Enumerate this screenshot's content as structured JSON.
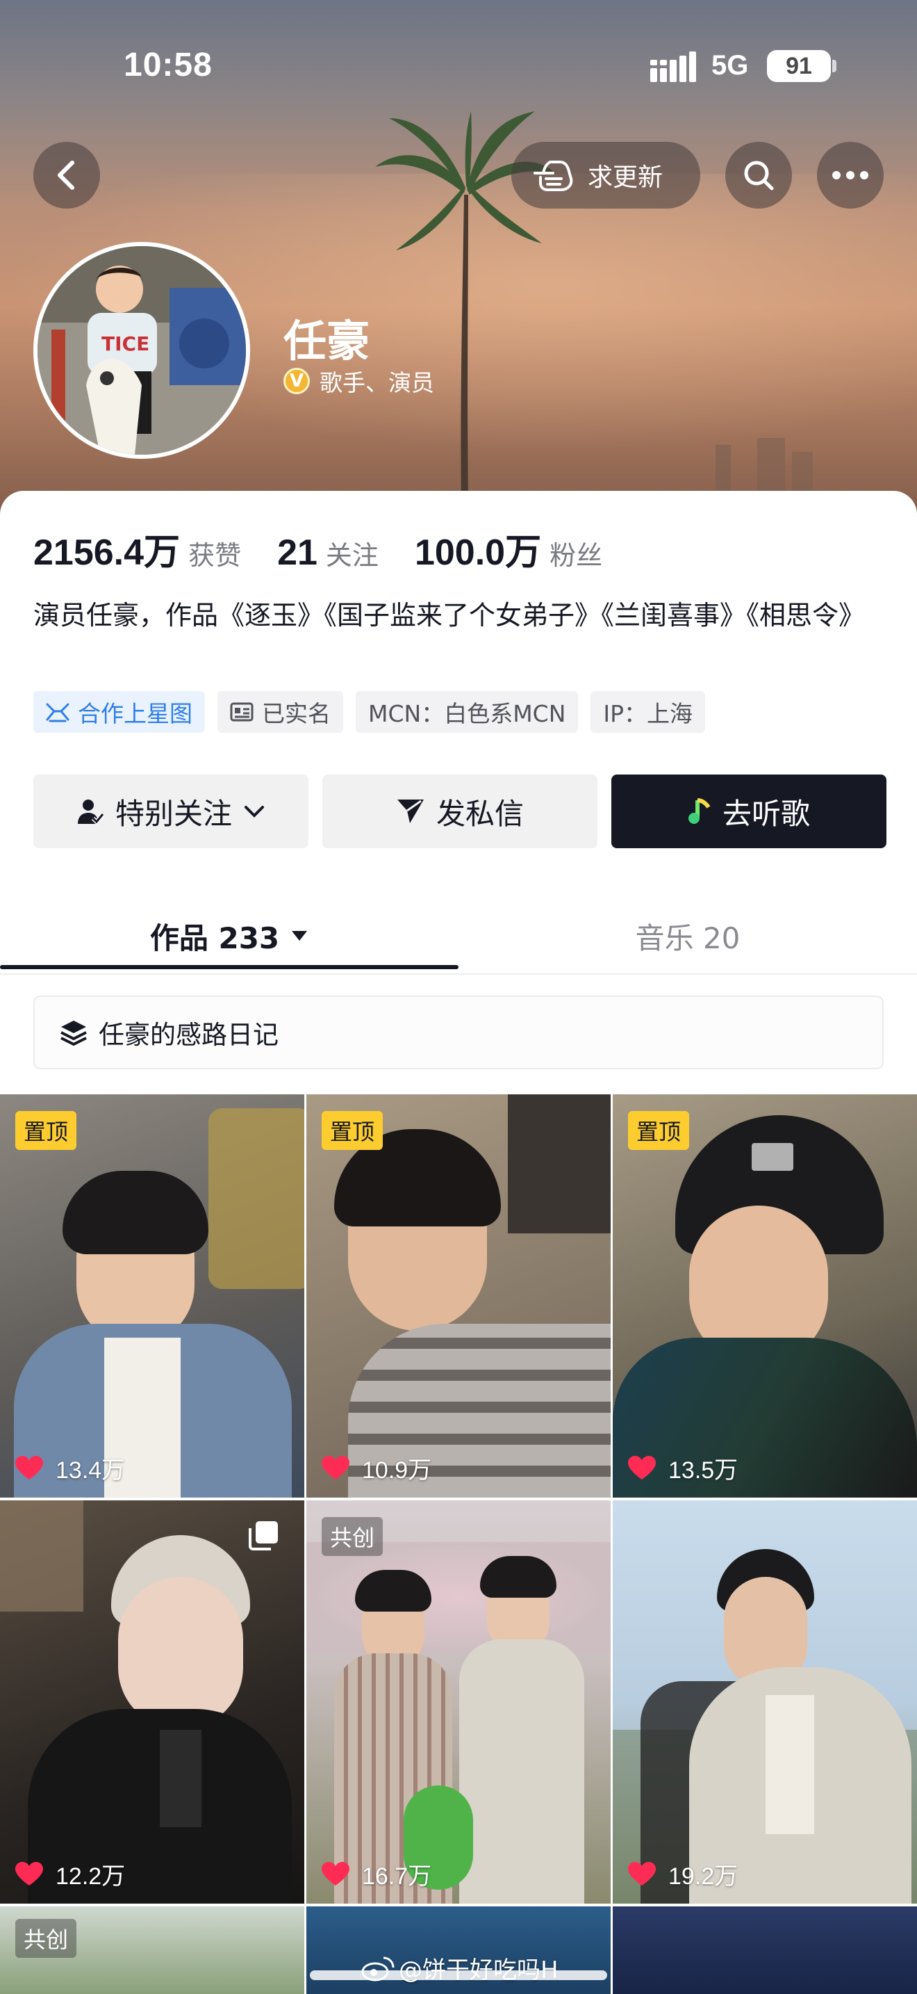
{
  "status_bar": {
    "time": "10:58",
    "network": "5G",
    "battery": "91"
  },
  "header": {
    "update_label": "求更新",
    "name": "任豪",
    "verify_letter": "V",
    "title": "歌手、演员"
  },
  "stats": [
    {
      "value": "2156.4万",
      "label": "获赞"
    },
    {
      "value": "21",
      "label": "关注"
    },
    {
      "value": "100.0万",
      "label": "粉丝"
    }
  ],
  "bio": "演员任豪，作品《逐玉》《国子监来了个女弟子》《兰闺喜事》《相思令》",
  "tags": [
    "合作上星图",
    "已实名",
    "MCN：白色系MCN",
    "IP：上海"
  ],
  "actions": {
    "special_follow": "特别关注",
    "message": "发私信",
    "listen": "去听歌"
  },
  "tabs": {
    "works": "作品 233",
    "music": "音乐 20"
  },
  "collection": "任豪的感路日记",
  "videos": [
    {
      "badge": "置顶",
      "likes": "13.4万"
    },
    {
      "badge": "置顶",
      "likes": "10.9万"
    },
    {
      "badge": "置顶",
      "likes": "13.5万"
    },
    {
      "badge": "",
      "likes": "12.2万"
    },
    {
      "badge": "共创",
      "likes": "16.7万"
    },
    {
      "badge": "",
      "likes": "19.2万"
    },
    {
      "badge": "共创",
      "likes": ""
    },
    {
      "badge": "",
      "likes": ""
    },
    {
      "badge": "",
      "likes": ""
    }
  ],
  "watermark": "@饼干好吃吗H",
  "colors": {
    "pin_badge": "#fdcd2f",
    "like_heart": "#fe2c55",
    "accent_blue": "#2f7ee8",
    "listen_bg": "#161823"
  }
}
